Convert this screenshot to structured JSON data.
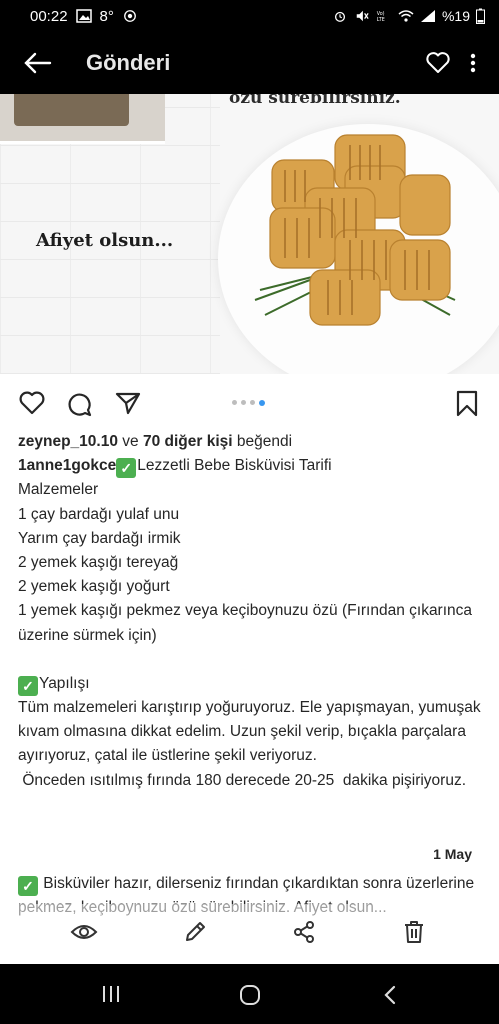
{
  "status_bar": {
    "time": "00:22",
    "temperature": "8°",
    "battery": "%19",
    "icons": [
      "gallery-icon",
      "weather-icon",
      "alarm-icon",
      "mute-icon",
      "volte-icon",
      "wifi-icon",
      "signal-icon",
      "battery-icon"
    ]
  },
  "app_bar": {
    "title": "Gönderi",
    "icons": [
      "back-arrow-icon",
      "heart-icon",
      "more-vertical-icon"
    ]
  },
  "post_image": {
    "overlay_top": "özü sürebilirsiniz.",
    "overlay_main": "Afiyet olsun..."
  },
  "actions": {
    "icons": [
      "like-icon",
      "comment-icon",
      "share-icon",
      "save-icon"
    ],
    "carousel_count": 4,
    "carousel_active": 4
  },
  "likes": {
    "user": "zeynep_10.10",
    "connector": " ve ",
    "others": "70 diğer kişi",
    "suffix": " beğendi"
  },
  "caption": {
    "username": "1anne1gokce",
    "title": "Lezzetli Bebe Bisküvisi Tarifi",
    "lines": [
      "Malzemeler",
      "1 çay bardağı yulaf unu",
      "Yarım çay bardağı irmik",
      "2 yemek kaşığı tereyağ",
      "2 yemek kaşığı yoğurt",
      "1 yemek kaşığı pekmez veya keçiboynuzu özü (Fırından çıkarınca üzerine sürmek için)",
      "",
      "Yapılışı",
      "Tüm malzemeleri karıştırıp yoğuruyoruz. Ele yapışmayan, yumuşak kıvam olmasına dikkat edelim. Uzun şekil verip, bıçakla parçalara ayırıyoruz, çatal ile üstlerine şekil veriyoruz.",
      " Önceden ısıtılmış fırında 180 derecede 20-25  dakika pişiriyoruz."
    ],
    "date": "1 May",
    "final": " Bisküviler hazır, dilerseniz fırından çıkardıktan sonra üzerlerine pekmez, keçiboynuzu özü sürebilirsiniz. Afiyet olsun..."
  },
  "toolbar": {
    "icons": [
      "eye-icon",
      "edit-icon",
      "share-network-icon",
      "trash-icon"
    ]
  },
  "nav_bar": {
    "icons": [
      "recents-icon",
      "home-icon",
      "back-icon"
    ]
  },
  "colors": {
    "accent": "#3897f0",
    "check": "#4caf50"
  }
}
